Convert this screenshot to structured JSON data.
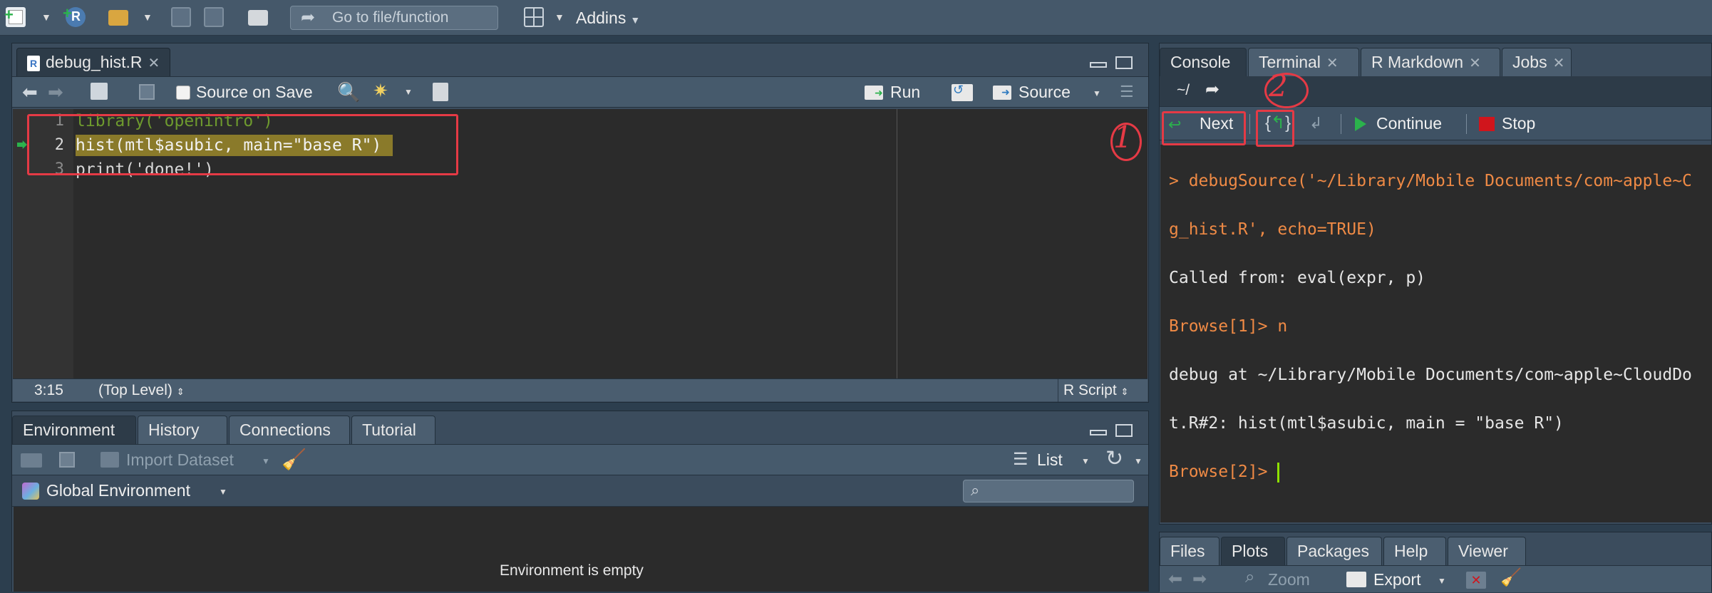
{
  "topbar": {
    "go_to_file_placeholder": "Go to file/function",
    "addins_label": "Addins"
  },
  "editor": {
    "tab_label": "debug_hist.R",
    "source_on_save_label": "Source on Save",
    "run_label": "Run",
    "source_label": "Source",
    "lines": [
      {
        "num": "1",
        "text": "library('openintro')"
      },
      {
        "num": "2",
        "text": "hist(mtl$asubic, main=\"base R\")"
      },
      {
        "num": "3",
        "text": "print('done!')"
      }
    ],
    "cursor_position": "3:15",
    "scope": "(Top Level)",
    "file_type": "R Script"
  },
  "environment_pane": {
    "tabs": [
      "Environment",
      "History",
      "Connections",
      "Tutorial"
    ],
    "import_dataset_label": "Import Dataset",
    "list_label": "List",
    "global_env_label": "Global Environment",
    "empty_message": "Environment is empty"
  },
  "console_pane": {
    "tabs": [
      "Console",
      "Terminal",
      "R Markdown",
      "Jobs"
    ],
    "path": "~/",
    "next_label": "Next",
    "continue_label": "Continue",
    "stop_label": "Stop",
    "output": [
      {
        "text": "> debugSource('~/Library/Mobile Documents/com~apple~C",
        "color": "orange"
      },
      {
        "text": "g_hist.R', echo=TRUE)",
        "color": "orange"
      },
      {
        "text": "Called from: eval(expr, p)",
        "color": "white"
      },
      {
        "text": "Browse[1]> n",
        "color": "orange"
      },
      {
        "text": "debug at ~/Library/Mobile Documents/com~apple~CloudDo",
        "color": "white"
      },
      {
        "text": "t.R#2: hist(mtl$asubic, main = \"base R\")",
        "color": "white"
      },
      {
        "text": "Browse[2]> ",
        "color": "orange"
      }
    ]
  },
  "files_pane": {
    "tabs": [
      "Files",
      "Plots",
      "Packages",
      "Help",
      "Viewer"
    ],
    "zoom_label": "Zoom",
    "export_label": "Export"
  },
  "annotations": {
    "one": "1",
    "two": "2"
  },
  "colors": {
    "accent_red": "#e53a45",
    "console_orange": "#ef8a45",
    "highlight_line": "#8a7a2a"
  }
}
